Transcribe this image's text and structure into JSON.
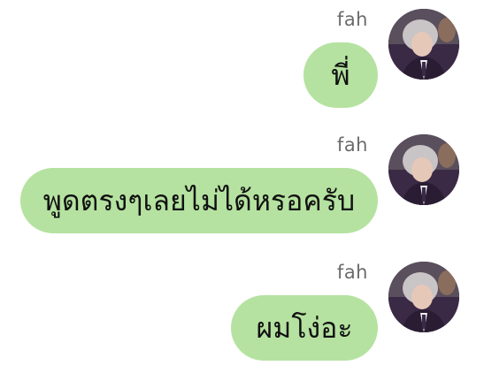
{
  "conversation": {
    "messages": [
      {
        "sender": "fah",
        "text": "พี่"
      },
      {
        "sender": "fah",
        "text": "พูดตรงๆเลยไม่ได้หรอครับ"
      },
      {
        "sender": "fah",
        "text": "ผมโง่อะ"
      }
    ]
  },
  "colors": {
    "bubble": "#b5e2a0",
    "sender_name": "#6b6b6b",
    "background": "#ffffff"
  },
  "icons": {
    "avatar": "profile-photo-avatar"
  }
}
